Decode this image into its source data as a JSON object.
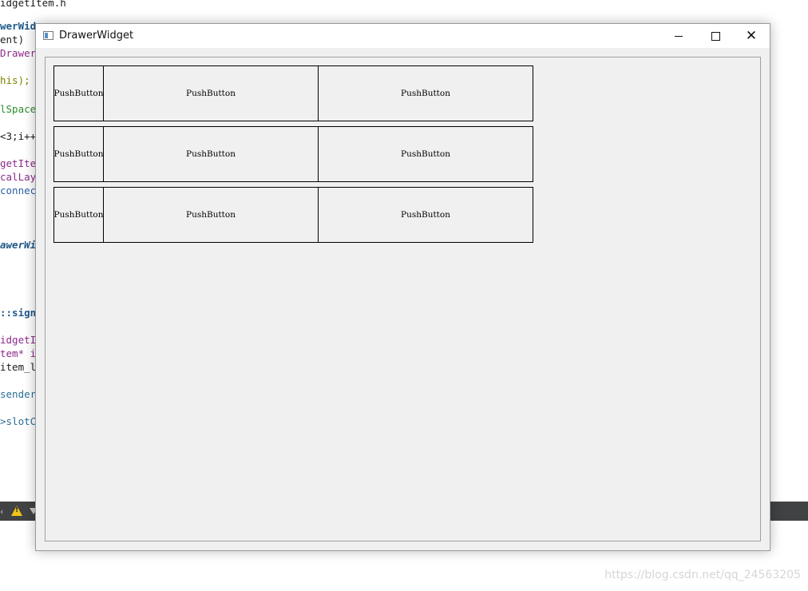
{
  "background_editor": {
    "code_lines": [
      {
        "text": "idgetItem.h",
        "cls": "c-plain"
      },
      {
        "text": "werWid",
        "cls": "c-kw"
      },
      {
        "text": "ent)",
        "cls": "c-plain"
      },
      {
        "text": "Drawer",
        "cls": "c-purple"
      },
      {
        "text": "his);",
        "cls": "c-olive"
      },
      {
        "text": "lSpace",
        "cls": "c-green"
      },
      {
        "text": "<3;i++",
        "cls": "c-plain"
      },
      {
        "text": "getIte",
        "cls": "c-purple"
      },
      {
        "text": "calLay",
        "cls": "c-purple"
      },
      {
        "text": "connec",
        "cls": "c-blue"
      },
      {
        "text": "awerWi",
        "cls": "c-kwi"
      },
      {
        "text": "::sign",
        "cls": "c-kw"
      },
      {
        "text": "idgetI",
        "cls": "c-purple"
      },
      {
        "text": "tem* i",
        "cls": "c-purple"
      },
      {
        "text": "item_l",
        "cls": "c-plain"
      },
      {
        "text": "sender",
        "cls": "c-teal"
      },
      {
        "text": ">slotC",
        "cls": "c-teal"
      }
    ]
  },
  "watermark": "https://blog.csdn.net/qq_24563205",
  "window": {
    "title": "DrawerWidget",
    "buttons": {
      "minimize": "minimize",
      "maximize": "maximize",
      "close": "close"
    }
  },
  "grid": {
    "rows": [
      {
        "buttons": [
          "PushButton",
          "PushButton",
          "PushButton"
        ]
      },
      {
        "buttons": [
          "PushButton",
          "PushButton",
          "PushButton"
        ]
      },
      {
        "buttons": [
          "PushButton",
          "PushButton",
          "PushButton"
        ]
      }
    ]
  },
  "colors": {
    "window_bg": "#f0f0f0",
    "titlebar_bg": "#ffffff",
    "editor_statusbar": "#404244",
    "warning_icon": "#f0c419"
  }
}
